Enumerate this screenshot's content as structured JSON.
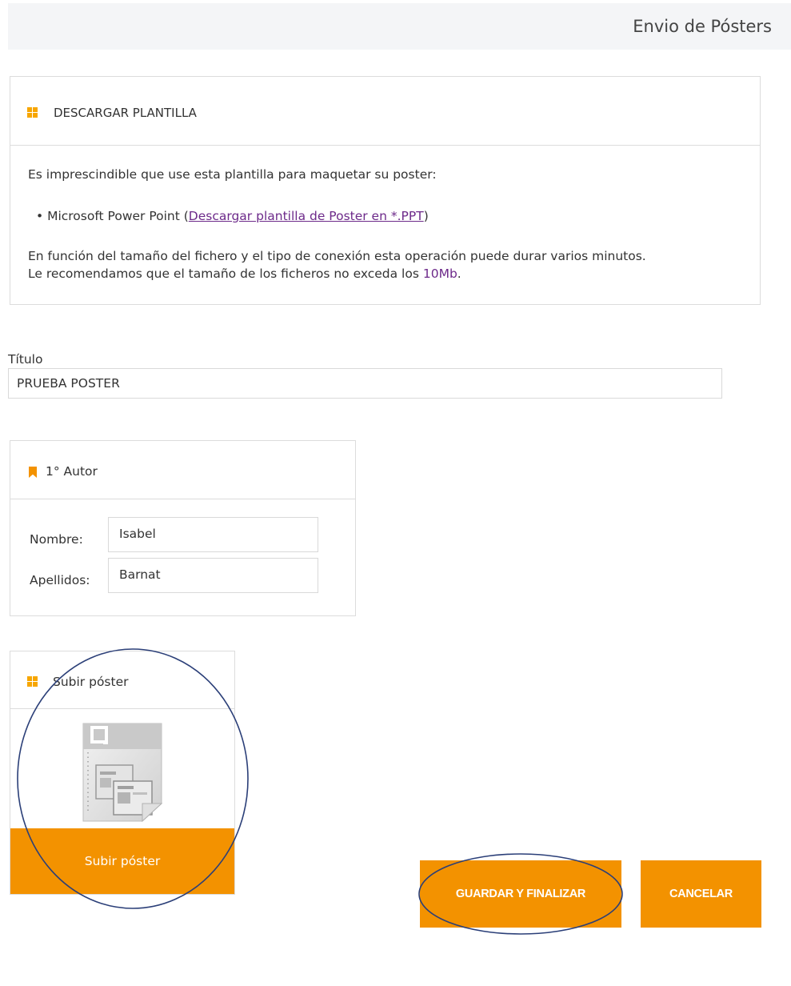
{
  "header": {
    "title": "Envio de Pósters"
  },
  "template_panel": {
    "title": "DESCARGAR PLANTILLA",
    "intro": "Es imprescindible que use esta plantilla para maquetar su poster:",
    "bullet_prefix": "Microsoft Power Point (",
    "download_link": "Descargar plantilla de Poster en *.PPT",
    "bullet_suffix": ")",
    "note_line1": "En función del tamaño del fichero y el tipo de conexión esta operación puede durar varios minutos.",
    "note_line2_prefix": "Le recomendamos que el tamaño de los ficheros no exceda los ",
    "size_limit": "10Mb",
    "note_line2_suffix": "."
  },
  "title_field": {
    "label": "Título",
    "value": "PRUEBA POSTER"
  },
  "author_panel": {
    "title": "1° Autor",
    "name_label": "Nombre:",
    "name_value": "Isabel",
    "surname_label": "Apellidos:",
    "surname_value": "Barnat"
  },
  "upload_panel": {
    "title": "Subir póster",
    "button_label": "Subir póster",
    "file_icon": "presentation-file-icon"
  },
  "actions": {
    "save_label": "GUARDAR Y FINALIZAR",
    "cancel_label": "CANCELAR"
  },
  "colors": {
    "accent": "#f39200",
    "link": "#6d2a8a",
    "annotation_circle": "#2b3f78"
  }
}
